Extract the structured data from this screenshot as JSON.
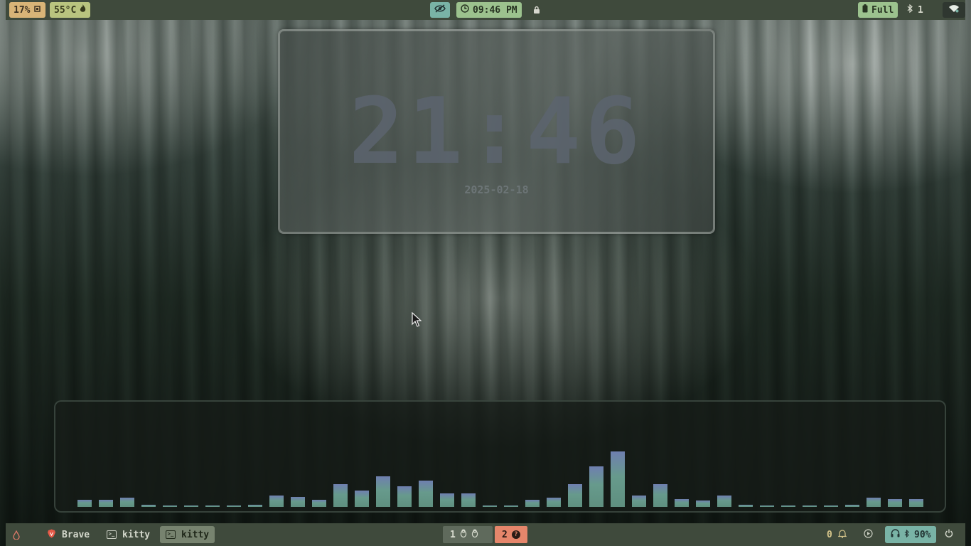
{
  "topbar": {
    "cpu": "17%",
    "cpu_icon": "cpu-icon",
    "temp": "55°C",
    "temp_icon": "flame-icon",
    "idle_icon": "eye-off-icon",
    "clock_icon": "clock-icon",
    "clock": "09:46 PM",
    "lock_icon": "lock-icon",
    "battery_icon": "battery-icon",
    "battery": "Full",
    "bluetooth_icon": "bluetooth-icon",
    "bluetooth_count": "1",
    "wifi_icon": "wifi-icon"
  },
  "clock_widget": {
    "time": "21:46",
    "date": "2025-02-18"
  },
  "visualizer": {
    "bar_color_top": "#6f8fa8",
    "bar_color": "#6a9a8a",
    "levels": [
      0.13,
      0.13,
      0.17,
      0.04,
      0.02,
      0.02,
      0.02,
      0.02,
      0.04,
      0.21,
      0.18,
      0.13,
      0.41,
      0.3,
      0.55,
      0.37,
      0.48,
      0.24,
      0.24,
      0.01,
      0.01,
      0.13,
      0.17,
      0.41,
      0.73,
      1.0,
      0.21,
      0.41,
      0.14,
      0.11,
      0.21,
      0.04,
      0.02,
      0.02,
      0.02,
      0.02,
      0.04,
      0.17,
      0.14,
      0.14
    ]
  },
  "bottombar": {
    "drop_icon": "drop-icon",
    "tasks": [
      {
        "label": "Brave",
        "icon": "brave-icon"
      },
      {
        "label": "kitty",
        "icon": "terminal-icon"
      },
      {
        "label": "kitty",
        "icon": "terminal-icon"
      }
    ],
    "workspace1": {
      "label": "1",
      "icons": [
        "tux-icon",
        "tux-icon"
      ]
    },
    "workspace2": {
      "label": "2",
      "icon": "question-icon"
    },
    "notifications": "0",
    "notification_icon": "bell-icon",
    "play_icon": "play-icon",
    "volume_icons": [
      "headphones-icon",
      "bluetooth-icon"
    ],
    "volume": "90%",
    "power_icon": "power-icon"
  },
  "colors": {
    "bar_bg": "#3f4a3c",
    "accent_cpu": "#d8b477",
    "accent_temp": "#b9c47f",
    "accent_teal": "#79b3a6",
    "accent_green": "#9cc28e",
    "accent_orange": "#e6866b"
  }
}
